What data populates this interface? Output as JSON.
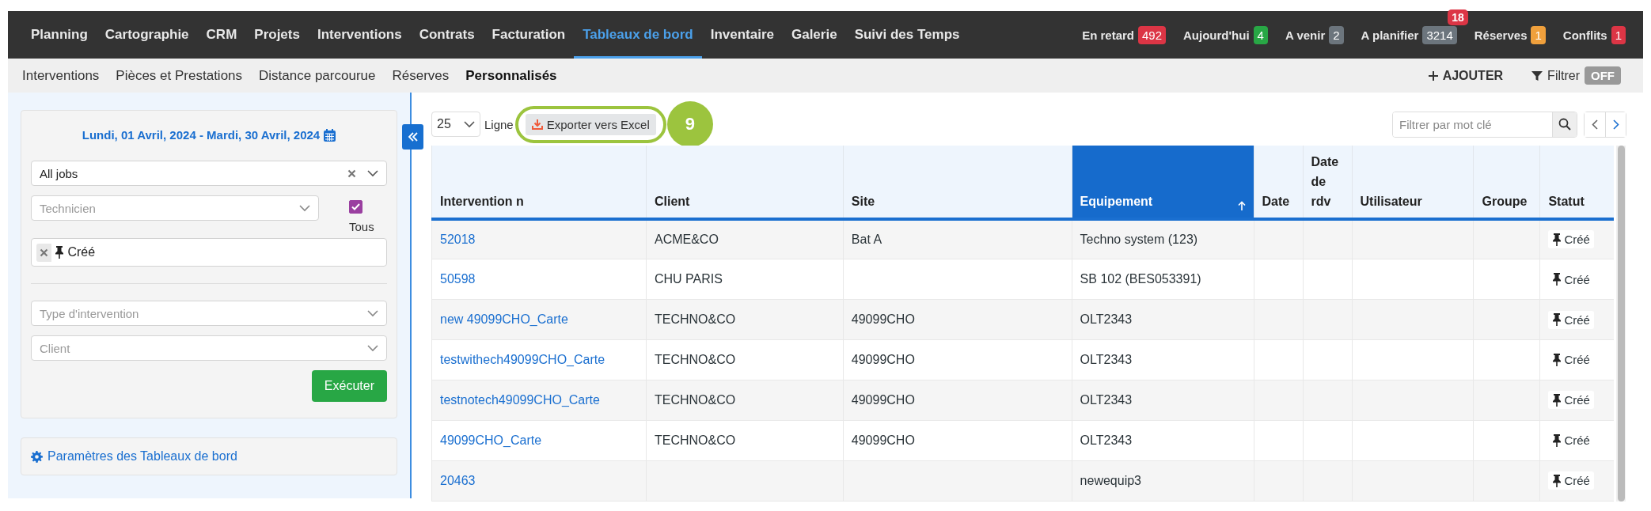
{
  "top_nav": {
    "items": [
      {
        "label": "Planning",
        "selected": false
      },
      {
        "label": "Cartographie",
        "selected": false
      },
      {
        "label": "CRM",
        "selected": false
      },
      {
        "label": "Projets",
        "selected": false
      },
      {
        "label": "Interventions",
        "selected": false
      },
      {
        "label": "Contrats",
        "selected": false
      },
      {
        "label": "Facturation",
        "selected": false
      },
      {
        "label": "Tableaux de bord",
        "selected": true
      },
      {
        "label": "Inventaire",
        "selected": false
      },
      {
        "label": "Galerie",
        "selected": false
      },
      {
        "label": "Suivi des Temps",
        "selected": false
      }
    ],
    "counters": [
      {
        "label": "En retard",
        "count": "492",
        "color": "#dc3545"
      },
      {
        "label": "Aujourd'hui",
        "count": "4",
        "color": "#28a745"
      },
      {
        "label": "A venir",
        "count": "2",
        "color": "#6c757d"
      },
      {
        "label": "A planifier",
        "count": "3214",
        "color": "#6c757d",
        "alert": "18"
      },
      {
        "label": "Réserves",
        "count": "1",
        "color": "#f0a03c"
      },
      {
        "label": "Conflits",
        "count": "1",
        "color": "#dc3545"
      }
    ]
  },
  "sub_nav": {
    "items": [
      {
        "label": "Interventions",
        "selected": false
      },
      {
        "label": "Pièces et Prestations",
        "selected": false
      },
      {
        "label": "Distance parcourue",
        "selected": false
      },
      {
        "label": "Réserves",
        "selected": false
      },
      {
        "label": "Personnalisés",
        "selected": true
      }
    ],
    "add_button": "AJOUTER",
    "filter_label": "Filtrer",
    "filter_toggle": {
      "label": "OFF",
      "on": false
    }
  },
  "sidebar": {
    "date_range": "Lundi, 01 Avril, 2024 - Mardi, 30 Avril, 2024",
    "job_select": "All jobs",
    "technician_placeholder": "Technicien",
    "all_checkbox": {
      "label": "Tous",
      "checked": true
    },
    "status_tags": [
      {
        "label": "Créé"
      }
    ],
    "type_placeholder": "Type d'intervention",
    "client_placeholder": "Client",
    "execute_button": "Exécuter",
    "settings_link": "Paramètres des Tableaux de bord"
  },
  "toolbar": {
    "page_size": "25",
    "rows_label": "Ligne",
    "export_button": "Exporter vers Excel",
    "callout": "9",
    "search_placeholder": "Filtrer par mot clé"
  },
  "table": {
    "columns": [
      {
        "label": "Intervention n",
        "sorted": false
      },
      {
        "label": "Client",
        "sorted": false
      },
      {
        "label": "Site",
        "sorted": false
      },
      {
        "label": "Equipement",
        "sorted": true
      },
      {
        "label": "Date",
        "sorted": false
      },
      {
        "label": "Date de rdv",
        "sorted": false
      },
      {
        "label": "Utilisateur",
        "sorted": false
      },
      {
        "label": "Groupe",
        "sorted": false
      },
      {
        "label": "Statut",
        "sorted": false
      }
    ],
    "rows": [
      {
        "cells": [
          "52018",
          "ACME&CO",
          "Bat A",
          "Techno system (123)",
          null,
          null,
          null,
          null,
          "Créé"
        ]
      },
      {
        "cells": [
          "50598",
          "CHU PARIS",
          null,
          "SB 102 (BES053391)",
          null,
          null,
          null,
          null,
          "Créé"
        ]
      },
      {
        "cells": [
          "new 49099CHO_Carte",
          "TECHNO&CO",
          "49099CHO",
          "OLT2343",
          null,
          null,
          null,
          null,
          "Créé"
        ]
      },
      {
        "cells": [
          "testwithech49099CHO_Carte",
          "TECHNO&CO",
          "49099CHO",
          "OLT2343",
          null,
          null,
          null,
          null,
          "Créé"
        ]
      },
      {
        "cells": [
          "testnotech49099CHO_Carte",
          "TECHNO&CO",
          "49099CHO",
          "OLT2343",
          null,
          null,
          null,
          null,
          "Créé"
        ]
      },
      {
        "cells": [
          "49099CHO_Carte",
          "TECHNO&CO",
          "49099CHO",
          "OLT2343",
          null,
          null,
          null,
          null,
          "Créé"
        ]
      },
      {
        "cells": [
          "20463",
          null,
          null,
          "newequip3",
          null,
          null,
          null,
          null,
          "Créé"
        ]
      }
    ]
  }
}
